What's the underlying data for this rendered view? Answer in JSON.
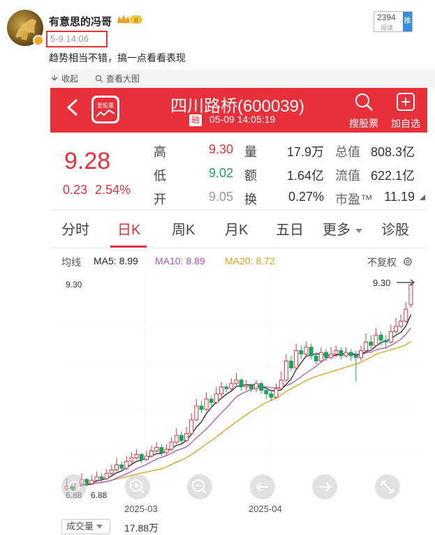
{
  "post": {
    "username": "有意思的冯哥",
    "vip_level": "II",
    "time": "5-9 14:06",
    "views": "2394",
    "views_label": "阅读",
    "push_label": "推广",
    "text": "趋势相当不错，搞一点看看表现"
  },
  "toolbar": {
    "collapse": "收起",
    "view_large": "查看大图"
  },
  "stock": {
    "app_logo_text": "爱股票",
    "title": "四川路桥(600039)",
    "rong": "融",
    "datetime": "05-09 14:05:19",
    "search_label": "搜股票",
    "add_label": "加自选",
    "price": "9.28",
    "change": "0.23",
    "change_pct": "2.54%",
    "quotes": {
      "high_label": "高",
      "high": "9.30",
      "low_label": "低",
      "low": "9.02",
      "open_label": "开",
      "open": "9.05",
      "vol_label": "量",
      "vol": "17.9万",
      "amt_label": "额",
      "amt": "1.64亿",
      "turn_label": "换",
      "turn": "0.27%",
      "mcap_label": "总值",
      "mcap": "808.3亿",
      "float_label": "流值",
      "float": "622.1亿",
      "pe_label": "市盈™",
      "pe": "11.19"
    },
    "tabs": [
      "分时",
      "日K",
      "周K",
      "月K",
      "五日",
      "更多",
      "诊股"
    ],
    "active_tab": "日K",
    "ma": {
      "label": "均线",
      "ma5": "MA5: 8.99",
      "ma10": "MA10: 8.89",
      "ma20": "MA20: 8.72",
      "adjust": "不复权",
      "colors": {
        "ma5": "#222222",
        "ma10": "#b050c8",
        "ma20": "#e0a010"
      }
    },
    "volume_select": "成交量",
    "volume_value": "17.88万"
  },
  "chart_data": {
    "type": "candlestick",
    "ylim": [
      6.88,
      9.3
    ],
    "y_top_label": "9.30",
    "y_bottom_label": "6.88",
    "high_marker": "9.30",
    "low_marker": "6.88",
    "x_labels": [
      "2025-03",
      "2025-04"
    ],
    "candles": [
      [
        6.92,
        6.95,
        7.05,
        6.9
      ],
      [
        6.95,
        6.9,
        6.98,
        6.88
      ],
      [
        6.9,
        6.98,
        7.0,
        6.88
      ],
      [
        6.98,
        7.03,
        7.1,
        6.95
      ],
      [
        7.03,
        6.98,
        7.05,
        6.95
      ],
      [
        6.98,
        7.02,
        7.08,
        6.96
      ],
      [
        7.02,
        7.06,
        7.12,
        7.0
      ],
      [
        7.06,
        7.04,
        7.1,
        7.0
      ],
      [
        7.04,
        7.1,
        7.15,
        7.02
      ],
      [
        7.1,
        7.14,
        7.2,
        7.08
      ],
      [
        7.14,
        7.2,
        7.28,
        7.12
      ],
      [
        7.2,
        7.16,
        7.24,
        7.12
      ],
      [
        7.16,
        7.24,
        7.3,
        7.14
      ],
      [
        7.24,
        7.28,
        7.34,
        7.2
      ],
      [
        7.28,
        7.32,
        7.38,
        7.26
      ],
      [
        7.32,
        7.26,
        7.34,
        7.22
      ],
      [
        7.26,
        7.3,
        7.36,
        7.24
      ],
      [
        7.3,
        7.36,
        7.42,
        7.28
      ],
      [
        7.36,
        7.4,
        7.46,
        7.32
      ],
      [
        7.4,
        7.34,
        7.44,
        7.3
      ],
      [
        7.34,
        7.38,
        7.44,
        7.3
      ],
      [
        7.38,
        7.46,
        7.52,
        7.36
      ],
      [
        7.46,
        7.54,
        7.62,
        7.44
      ],
      [
        7.54,
        7.48,
        7.58,
        7.44
      ],
      [
        7.48,
        7.56,
        7.64,
        7.46
      ],
      [
        7.56,
        7.72,
        7.8,
        7.54
      ],
      [
        7.72,
        7.88,
        7.96,
        7.7
      ],
      [
        7.88,
        7.84,
        7.94,
        7.8
      ],
      [
        7.84,
        7.96,
        8.04,
        7.82
      ],
      [
        7.96,
        7.92,
        8.0,
        7.86
      ],
      [
        7.92,
        8.02,
        8.1,
        7.9
      ],
      [
        8.02,
        8.1,
        8.16,
        7.98
      ],
      [
        8.1,
        8.08,
        8.14,
        8.04
      ],
      [
        8.08,
        8.14,
        8.2,
        8.06
      ],
      [
        8.14,
        8.18,
        8.26,
        8.1
      ],
      [
        8.18,
        8.1,
        8.2,
        8.06
      ],
      [
        8.1,
        8.12,
        8.18,
        8.06
      ],
      [
        8.12,
        8.08,
        8.14,
        8.04
      ],
      [
        8.08,
        8.14,
        8.18,
        8.04
      ],
      [
        8.14,
        8.06,
        8.16,
        8.02
      ],
      [
        8.06,
        8.02,
        8.1,
        7.96
      ],
      [
        8.02,
        7.98,
        8.06,
        7.94
      ],
      [
        7.98,
        8.08,
        8.14,
        7.96
      ],
      [
        8.08,
        8.18,
        8.28,
        8.06
      ],
      [
        8.18,
        8.4,
        8.48,
        8.16
      ],
      [
        8.4,
        8.32,
        8.46,
        8.28
      ],
      [
        8.32,
        8.52,
        8.6,
        8.3
      ],
      [
        8.52,
        8.48,
        8.58,
        8.42
      ],
      [
        8.48,
        8.56,
        8.62,
        8.44
      ],
      [
        8.56,
        8.46,
        8.6,
        8.42
      ],
      [
        8.46,
        8.4,
        8.5,
        8.36
      ],
      [
        8.4,
        8.5,
        8.56,
        8.38
      ],
      [
        8.5,
        8.44,
        8.54,
        8.4
      ],
      [
        8.44,
        8.48,
        8.56,
        8.42
      ],
      [
        8.48,
        8.52,
        8.58,
        8.44
      ],
      [
        8.52,
        8.46,
        8.56,
        8.42
      ],
      [
        8.46,
        8.5,
        8.56,
        8.44
      ],
      [
        8.5,
        8.46,
        8.54,
        8.4
      ],
      [
        8.46,
        8.44,
        8.52,
        8.16
      ],
      [
        8.44,
        8.52,
        8.58,
        8.4
      ],
      [
        8.52,
        8.62,
        8.72,
        8.5
      ],
      [
        8.62,
        8.58,
        8.7,
        8.54
      ],
      [
        8.58,
        8.7,
        8.78,
        8.56
      ],
      [
        8.7,
        8.64,
        8.74,
        8.58
      ],
      [
        8.64,
        8.62,
        8.7,
        8.54
      ],
      [
        8.62,
        8.74,
        8.82,
        8.6
      ],
      [
        8.74,
        8.8,
        8.9,
        8.72
      ],
      [
        8.8,
        8.86,
        8.94,
        8.78
      ],
      [
        8.86,
        9.0,
        9.08,
        8.84
      ],
      [
        9.05,
        9.28,
        9.3,
        9.02
      ]
    ]
  }
}
